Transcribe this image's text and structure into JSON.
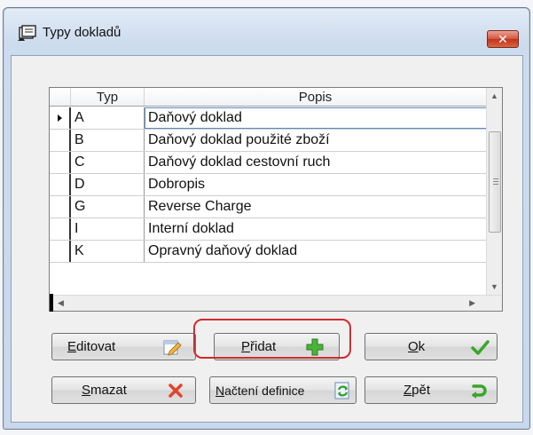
{
  "window": {
    "title": "Typy dokladů"
  },
  "grid": {
    "columns": [
      "Typ",
      "Popis"
    ],
    "rows": [
      {
        "typ": "A",
        "popis": "Daňový doklad"
      },
      {
        "typ": "B",
        "popis": "Daňový doklad použité zboží"
      },
      {
        "typ": "C",
        "popis": "Daňový doklad cestovní ruch"
      },
      {
        "typ": "D",
        "popis": "Dobropis"
      },
      {
        "typ": "G",
        "popis": "Reverse Charge"
      },
      {
        "typ": "I",
        "popis": "Interní doklad"
      },
      {
        "typ": "K",
        "popis": "Opravný daňový doklad"
      }
    ],
    "selected_row": 0
  },
  "buttons": {
    "editovat": {
      "mnemonic": "E",
      "rest": "ditovat"
    },
    "pridat": {
      "mnemonic": "P",
      "rest": "řidat"
    },
    "ok": {
      "mnemonic": "O",
      "rest": "k"
    },
    "smazat": {
      "mnemonic": "S",
      "rest": "mazat"
    },
    "nacteni": {
      "mnemonic": "N",
      "rest": "ačtení definice"
    },
    "zpet": {
      "mnemonic": "Z",
      "rest": "pět"
    }
  },
  "colors": {
    "accent_red": "#d22b2b",
    "ok_green": "#3aa52b",
    "add_green": "#2f9e2a",
    "delete_red": "#e0452c"
  }
}
